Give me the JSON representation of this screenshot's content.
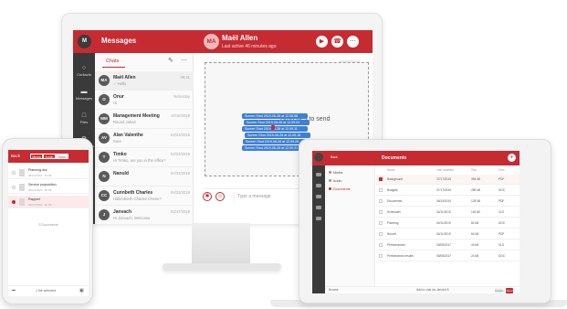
{
  "colors": {
    "accent": "#c62b31",
    "nav_dark": "#3a3a3a",
    "selection_blue": "#3e7fd8"
  },
  "desktop": {
    "user_avatar": "M",
    "app_title": "Messages",
    "contact": {
      "initials": "MA",
      "name": "Maël Allen",
      "status": "Last active 46 minutes ago"
    },
    "toolbar_icons": [
      "video-icon",
      "phone-icon",
      "more-icon"
    ],
    "nav": [
      {
        "label": "Contacts",
        "icon": "person-icon",
        "glyph": "○"
      },
      {
        "label": "Messages",
        "icon": "message-icon",
        "glyph": "▬"
      },
      {
        "label": "Files",
        "icon": "folder-icon",
        "glyph": "□"
      },
      {
        "label": "Preferences",
        "icon": "gear-icon",
        "glyph": "⚙"
      }
    ],
    "chats_tab": "Chats",
    "chats": [
      {
        "initials": "MA",
        "name": "Maël Allen",
        "preview": "✓ Hello",
        "date": "09:41"
      },
      {
        "initials": "O",
        "name": "Onur",
        "preview": "Hi",
        "date": "Yesterday"
      },
      {
        "initials": "MM",
        "name": "Management Meeting",
        "preview": "Round Jahari",
        "date": "10/10/2019"
      },
      {
        "initials": "AV",
        "name": "Alan Valenthe",
        "preview": "Sure",
        "date": "04/23/2019"
      },
      {
        "initials": "T",
        "name": "Timko",
        "preview": "Hi Timko, are you in the office?",
        "date": "04/23/2019"
      },
      {
        "initials": "N",
        "name": "Nanuld",
        "preview": "",
        "date": "04/23/2019"
      },
      {
        "initials": "CC",
        "name": "Cunnbeth Charles",
        "preview": "Hallenberth Charles Cherie?",
        "date": "04/23/2019"
      },
      {
        "initials": "J",
        "name": "Janvach",
        "preview": "Hi Janvach, Welcome",
        "date": "03/17/2019"
      }
    ],
    "drop_text": "Drop files to send",
    "bubble_text": "Hello",
    "dragged_files": [
      "Screen Shot 2019-06-28 at 12.08.58",
      "Screen Shot 2019-06-28 at 12.09.04",
      "Screen Shot 2019-06-28 at 12.09.11",
      "Screen Shot 2019-06-28 at 12.09.18",
      "Screen Shot 2019-06-28 at 12.09.25",
      "Screen Shot 2019-06-28 at 12.09.31"
    ],
    "composer_placeholder": "Type a message"
  },
  "phone": {
    "back": "Back",
    "segments": [
      "Media",
      "Audio",
      "Docs"
    ],
    "active_segment": 2,
    "files": [
      {
        "name": "Planning.doc",
        "meta": "08/21/2019 · 34 kB",
        "selected": false
      },
      {
        "name": "Service proposition",
        "meta": "08/21/2019 · 58 kB",
        "selected": false
      },
      {
        "name": "Rapport",
        "meta": "08/21/2019 · 42 kB",
        "selected": true
      }
    ],
    "count": "3 Documents",
    "footer": "1 file selected"
  },
  "tablet": {
    "back": "Back",
    "title": "Documents",
    "sidebar": [
      {
        "label": "Media",
        "active": false
      },
      {
        "label": "Audio",
        "active": false
      },
      {
        "label": "Documents",
        "active": true
      }
    ],
    "columns": [
      "Name",
      "Last modified",
      "Size",
      "Kind"
    ],
    "rows": [
      {
        "name": "Background",
        "date": "07/17/2019",
        "size": "394 kB",
        "kind": "PDF",
        "selected": true
      },
      {
        "name": "Budgets",
        "date": "07/17/2019",
        "size": "289 kB",
        "kind": "DOC",
        "selected": false
      },
      {
        "name": "Documents",
        "date": "05/14/2019",
        "size": "128 kB",
        "kind": "PDF",
        "selected": false
      },
      {
        "name": "Schedules",
        "date": "04/11/2019",
        "size": "118 kB",
        "kind": "XLS",
        "selected": false
      },
      {
        "name": "Planning",
        "date": "04/11/2019",
        "size": "82 kB",
        "kind": "DOC",
        "selected": false
      },
      {
        "name": "Nouvel",
        "date": "04/11/2019",
        "size": "64 kB",
        "kind": "PDF",
        "selected": false
      },
      {
        "name": "Performances",
        "date": "03/08/2017",
        "size": "40 kB",
        "kind": "XLS",
        "selected": false
      },
      {
        "name": "Performance-results",
        "date": "03/08/2017",
        "size": "24 kB",
        "kind": "DOC",
        "selected": false
      }
    ],
    "footer_left": "Browse",
    "footer_center": "Add to chat via Janvich 8",
    "footer_buttons": [
      "Cancel",
      "Send"
    ]
  }
}
